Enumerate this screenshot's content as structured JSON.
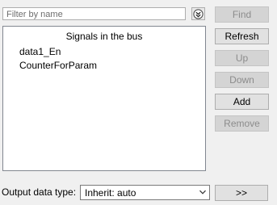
{
  "filter": {
    "placeholder": "Filter by name",
    "value": ""
  },
  "buttons": {
    "find": "Find",
    "refresh": "Refresh",
    "up": "Up",
    "down": "Down",
    "add": "Add",
    "remove": "Remove"
  },
  "signals_list": {
    "header": "Signals in the bus",
    "items": [
      "data1_En",
      "CounterForParam"
    ]
  },
  "output": {
    "label": "Output data type:",
    "selected": "Inherit: auto",
    "expand_button": ">>"
  }
}
